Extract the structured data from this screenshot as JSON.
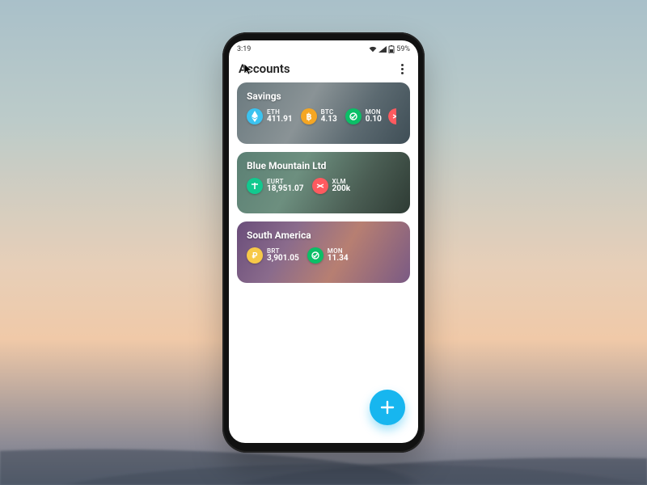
{
  "statusbar": {
    "time": "3:19",
    "battery_text": "59%"
  },
  "appbar": {
    "title": "Accounts"
  },
  "colors": {
    "fab": "#17b6ef",
    "eth": "#3bc3f0",
    "btc": "#f5a623",
    "mon": "#0bbf67",
    "xlm": "#ff5a5f",
    "eurt": "#12c98f",
    "brt": "#f7c948",
    "petro": "#f7c948"
  },
  "accounts": [
    {
      "name": "Savings",
      "balances": [
        {
          "symbol": "ETH",
          "value": "411.91",
          "icon": "eth"
        },
        {
          "symbol": "BTC",
          "value": "4.13",
          "icon": "btc"
        },
        {
          "symbol": "MON",
          "value": "0.10",
          "icon": "mon"
        }
      ],
      "overflow_icon": "xlm"
    },
    {
      "name": "Blue Mountain Ltd",
      "balances": [
        {
          "symbol": "EURT",
          "value": "18,951.07",
          "icon": "eurt"
        },
        {
          "symbol": "XLM",
          "value": "200k",
          "icon": "xlm"
        }
      ]
    },
    {
      "name": "South America",
      "balances": [
        {
          "symbol": "BRT",
          "value": "3,901.05",
          "icon": "brt"
        },
        {
          "symbol": "MON",
          "value": "11.34",
          "icon": "mon"
        }
      ]
    }
  ]
}
